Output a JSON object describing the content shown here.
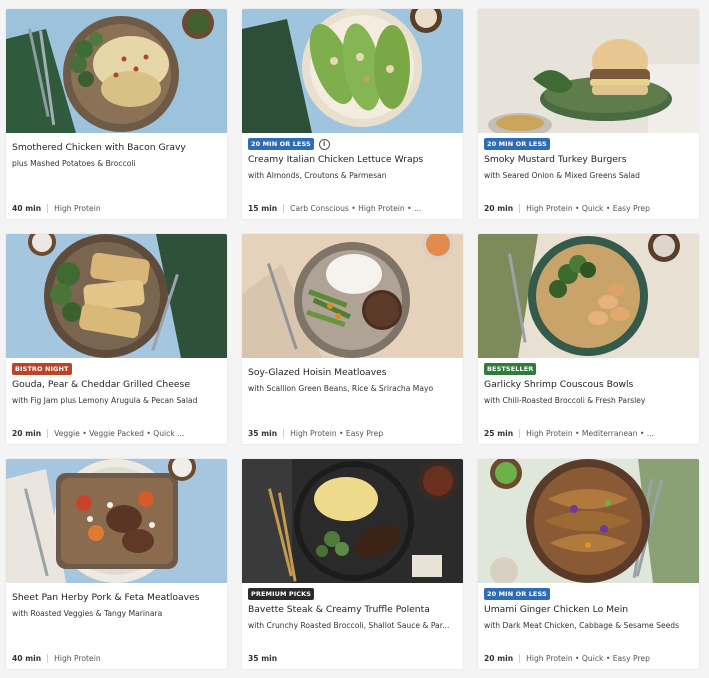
{
  "colors": {
    "badge_green": "#2f6cb8",
    "badge_bistro": "#b8452a",
    "badge_bestseller": "#2e7d3a",
    "badge_premium": "#2b2b2b"
  },
  "recipes": [
    {
      "badge": "",
      "title": "Smothered Chicken with Bacon Gravy",
      "subtitle": "plus Mashed Potatoes & Broccoli",
      "time": "40 min",
      "tags": "High Protein"
    },
    {
      "badge": "20 MIN OR LESS",
      "title": "Creamy Italian Chicken Lettuce Wraps",
      "subtitle": "with Almonds, Croutons & Parmesan",
      "time": "15 min",
      "tags": "Carb Conscious • High Protein • ..."
    },
    {
      "badge": "20 MIN OR LESS",
      "title": "Smoky Mustard Turkey Burgers",
      "subtitle": "with Seared Onion & Mixed Greens Salad",
      "time": "20 min",
      "tags": "High Protein • Quick • Easy Prep"
    },
    {
      "badge": "BISTRO NIGHT",
      "title": "Gouda, Pear & Cheddar Grilled Cheese",
      "subtitle": "with Fig Jam plus Lemony Arugula & Pecan Salad",
      "time": "20 min",
      "tags": "Veggie • Veggie Packed • Quick ..."
    },
    {
      "badge": "",
      "title": "Soy-Glazed Hoisin Meatloaves",
      "subtitle": "with Scallion Green Beans, Rice & Sriracha Mayo",
      "time": "35 min",
      "tags": "High Protein • Easy Prep"
    },
    {
      "badge": "BESTSELLER",
      "title": "Garlicky Shrimp Couscous Bowls",
      "subtitle": "with Chili-Roasted Broccoli & Fresh Parsley",
      "time": "25 min",
      "tags": "High Protein • Mediterranean • ..."
    },
    {
      "badge": "",
      "title": "Sheet Pan Herby Pork & Feta Meatloaves",
      "subtitle": "with Roasted Veggies & Tangy Marinara",
      "time": "40 min",
      "tags": "High Protein"
    },
    {
      "badge": "PREMIUM PICKS",
      "title": "Bavette Steak & Creamy Truffle Polenta",
      "subtitle": "with Crunchy Roasted Broccoli, Shallot Sauce & Par...",
      "time": "35 min",
      "tags": ""
    },
    {
      "badge": "20 MIN OR LESS",
      "title": "Umami Ginger Chicken Lo Mein",
      "subtitle": "with Dark Meat Chicken, Cabbage & Sesame Seeds",
      "time": "20 min",
      "tags": "High Protein • Quick • Easy Prep"
    }
  ],
  "info_icon": "info-icon"
}
